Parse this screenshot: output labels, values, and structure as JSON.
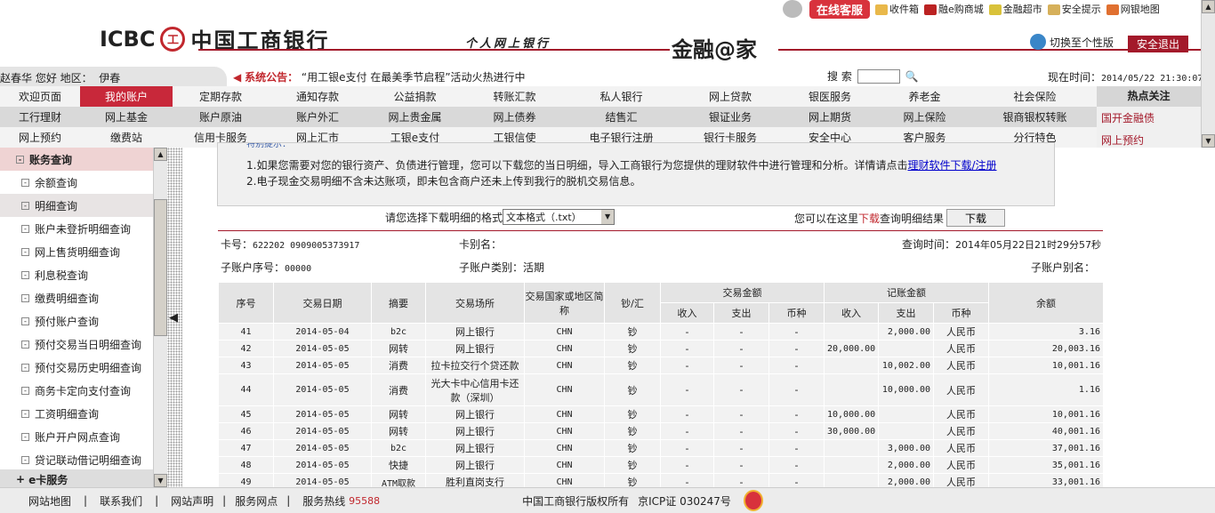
{
  "top_links": {
    "online_service": "在线客服",
    "items": [
      "收件箱",
      "融e购商城",
      "金融超市",
      "安全提示",
      "网银地图"
    ]
  },
  "brand": {
    "name": "中国工商银行",
    "icbc": "ICBC",
    "seal": "工",
    "subtitle": "个人网上银行",
    "slogan": "金融@家"
  },
  "header": {
    "switch_label": "切换至个性版",
    "logout_label": "安全退出",
    "greeting": "赵春华 您好 地区：",
    "region": "伊春",
    "notice_label": "系统公告：",
    "notice_text": "“用工银e支付 在最美季节启程”活动火热进行中",
    "search_label": "搜 索",
    "time_label": "现在时间：",
    "time_value": "2014/05/22 21:30:07"
  },
  "nav": {
    "rows": [
      [
        "欢迎页面",
        "我的账户",
        "定期存款",
        "通知存款",
        "公益捐款",
        "转账汇款",
        "私人银行",
        "网上贷款",
        "银医服务",
        "养老金",
        "社会保险"
      ],
      [
        "工行理财",
        "网上基金",
        "账户原油",
        "账户外汇",
        "网上贵金属",
        "网上债券",
        "结售汇",
        "银证业务",
        "网上期货",
        "网上保险",
        "银商银权转账"
      ],
      [
        "网上预约",
        "缴费站",
        "信用卡服务",
        "网上汇市",
        "工银e支付",
        "工银信使",
        "电子银行注册",
        "银行卡服务",
        "安全中心",
        "客户服务",
        "分行特色"
      ]
    ]
  },
  "hot": {
    "title": "热点关注",
    "items": [
      "国开金融债",
      "网上预约"
    ]
  },
  "sidebar": {
    "section": "账务查询",
    "items": [
      "余额查询",
      "明细查询",
      "账户未登折明细查询",
      "网上售货明细查询",
      "利息税查询",
      "缴费明细查询",
      "预付账户查询",
      "预付交易当日明细查询",
      "预付交易历史明细查询",
      "商务卡定向支付查询",
      "工资明细查询",
      "账户开户网点查询",
      "贷记联动借记明细查询"
    ],
    "next_section": "e卡服务"
  },
  "notice_box": {
    "title": "特别提示：",
    "line1": "1.如果您需要对您的银行资产、负债进行管理，您可以下载您的当日明细，导入工商银行为您提供的理财软件中进行管理和分析。详情请点击",
    "line1_link": "理财软件下载/注册",
    "line2": "2.电子现金交易明细不含未达账项，即未包含商户还未上传到我行的脱机交易信息。"
  },
  "download": {
    "format_label": "请您选择下载明细的格式",
    "format_value": "文本格式（.txt）",
    "hint_pre": "您可以在这里",
    "hint_red": "下载",
    "hint_post": "查询明细结果",
    "button": "下载"
  },
  "account": {
    "card_label": "卡号：",
    "card_no": "622202 0909005373917",
    "alias_label": "卡别名：",
    "query_time_label": "查询时间：",
    "query_time": "2014年05月22日21时29分57秒",
    "sub_no_label": "子账户序号：",
    "sub_no": "00000",
    "sub_type_label": "子账户类别：",
    "sub_type": "活期",
    "sub_alias_label": "子账户别名："
  },
  "table": {
    "headers": [
      "序号",
      "交易日期",
      "摘要",
      "交易场所",
      "交易国家或地区简称",
      "钞/汇",
      "交易金额",
      "记账金额",
      "余额"
    ],
    "sub_headers": [
      "收入",
      "支出",
      "币种",
      "收入",
      "支出",
      "币种"
    ],
    "rows": [
      [
        "41",
        "2014-05-04",
        "b2c",
        "网上银行",
        "CHN",
        "钞",
        "-",
        "-",
        "-",
        "",
        "2,000.00",
        "人民币",
        "3.16"
      ],
      [
        "42",
        "2014-05-05",
        "网转",
        "网上银行",
        "CHN",
        "钞",
        "-",
        "-",
        "-",
        "20,000.00",
        "",
        "人民币",
        "20,003.16"
      ],
      [
        "43",
        "2014-05-05",
        "消费",
        "拉卡拉交行个贷还款",
        "CHN",
        "钞",
        "-",
        "-",
        "-",
        "",
        "10,002.00",
        "人民币",
        "10,001.16"
      ],
      [
        "44",
        "2014-05-05",
        "消费",
        "光大卡中心信用卡还款（深圳）",
        "CHN",
        "钞",
        "-",
        "-",
        "-",
        "",
        "10,000.00",
        "人民币",
        "1.16"
      ],
      [
        "45",
        "2014-05-05",
        "网转",
        "网上银行",
        "CHN",
        "钞",
        "-",
        "-",
        "-",
        "10,000.00",
        "",
        "人民币",
        "10,001.16"
      ],
      [
        "46",
        "2014-05-05",
        "网转",
        "网上银行",
        "CHN",
        "钞",
        "-",
        "-",
        "-",
        "30,000.00",
        "",
        "人民币",
        "40,001.16"
      ],
      [
        "47",
        "2014-05-05",
        "b2c",
        "网上银行",
        "CHN",
        "钞",
        "-",
        "-",
        "-",
        "",
        "3,000.00",
        "人民币",
        "37,001.16"
      ],
      [
        "48",
        "2014-05-05",
        "快捷",
        "网上银行",
        "CHN",
        "钞",
        "-",
        "-",
        "-",
        "",
        "2,000.00",
        "人民币",
        "35,001.16"
      ],
      [
        "49",
        "2014-05-05",
        "ATM取款",
        "胜利直岗支行",
        "CHN",
        "钞",
        "-",
        "-",
        "-",
        "",
        "2,000.00",
        "人民币",
        "33,001.16"
      ]
    ]
  },
  "footer": {
    "links": [
      "网站地图",
      "联系我们",
      "网站声明",
      "服务网点"
    ],
    "hotline_label": "服务热线",
    "hotline": "95588",
    "copyright": "中国工商银行版权所有",
    "icp": "京ICP证 030247号"
  },
  "colors": {
    "brand_red": "#c8283a"
  }
}
